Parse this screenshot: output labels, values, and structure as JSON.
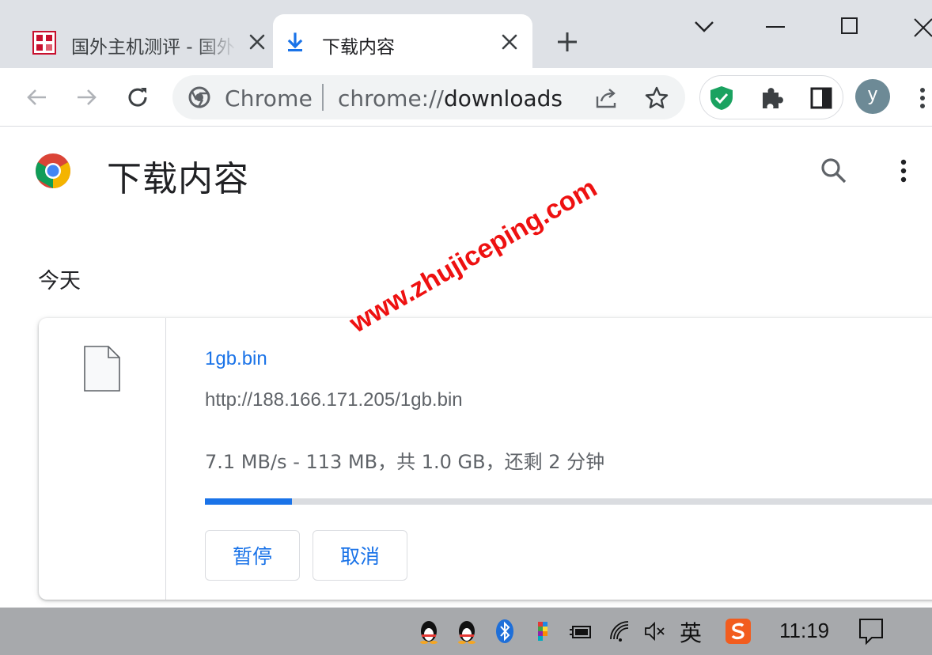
{
  "tabs": [
    {
      "title": "国外主机测评 - 国外",
      "active": false,
      "favicon": "site-favicon"
    },
    {
      "title": "下载内容",
      "active": true,
      "favicon": "download-icon"
    }
  ],
  "toolbar": {
    "omnibox_scheme_label": "Chrome",
    "omnibox_url_prefix": "chrome://",
    "omnibox_url_path": "downloads",
    "avatar_letter": "y"
  },
  "page": {
    "title": "下载内容",
    "section_label": "今天"
  },
  "download": {
    "file_name": "1gb.bin",
    "url": "http://188.166.171.205/1gb.bin",
    "status": "7.1 MB/s - 113 MB，共 1.0 GB，还剩 2 分钟",
    "progress_fraction": 0.116,
    "pause_label": "暂停",
    "cancel_label": "取消"
  },
  "watermark": "www.zhujiceping.com",
  "taskbar": {
    "ime_label": "英",
    "clock": "11:19"
  },
  "colors": {
    "accent": "#1a73e8",
    "tabstrip": "#dee1e6",
    "taskbar": "#a7a9ac",
    "watermark": "#ee1111"
  }
}
